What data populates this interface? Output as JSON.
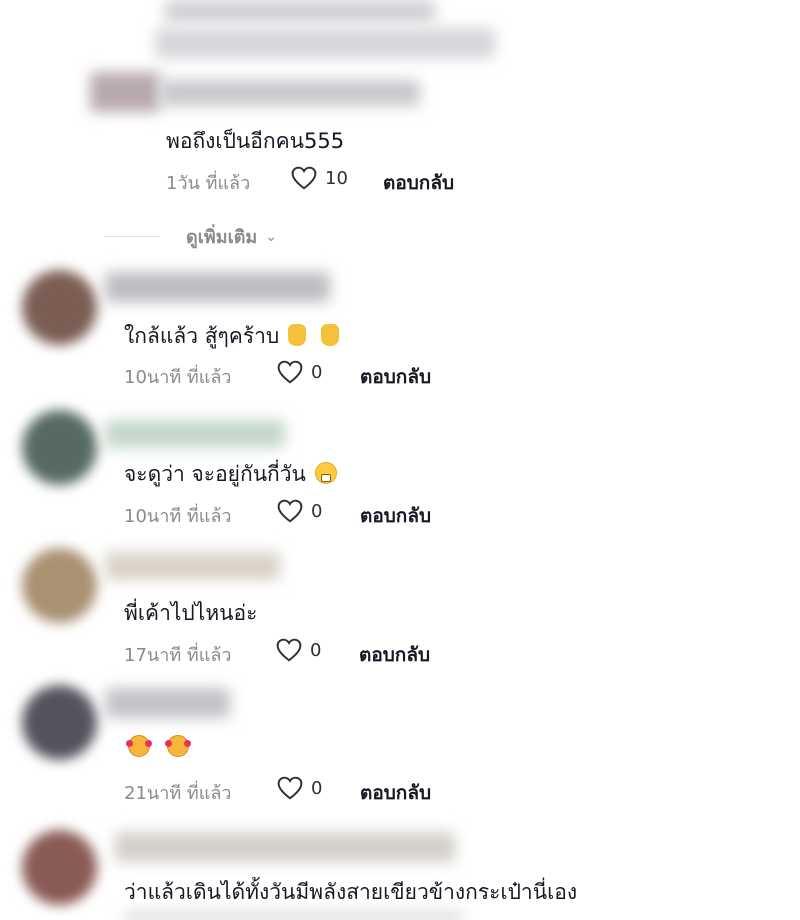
{
  "comments": [
    {
      "text": "พอถึงเป็นอีกคน555",
      "time": "1วัน ที่แล้ว",
      "likes": "10",
      "reply": "ตอบกลับ"
    },
    {
      "text": "ใกล้แล้ว สู้ๆคร้าบ",
      "emojis": [
        "victory-hand-emoji",
        "victory-hand-emoji"
      ],
      "time": "10นาที ที่แล้ว",
      "likes": "0",
      "reply": "ตอบกลับ"
    },
    {
      "text": "จะดูว่า จะอยู่กันกี่วัน",
      "emojis": [
        "grinning-face-emoji"
      ],
      "time": "10นาที ที่แล้ว",
      "likes": "0",
      "reply": "ตอบกลับ"
    },
    {
      "text": "พี่เค้าไปไหนอ่ะ",
      "time": "17นาที ที่แล้ว",
      "likes": "0",
      "reply": "ตอบกลับ"
    },
    {
      "text": "",
      "emojis": [
        "smiling-face-with-hearts-emoji",
        "smiling-face-with-hearts-emoji"
      ],
      "time": "21นาที ที่แล้ว",
      "likes": "0",
      "reply": "ตอบกลับ"
    },
    {
      "text": "ว่าแล้วเดินได้ทั้งวันมีพลังสายเขียวข้างกระเป๋านี่เอง"
    }
  ],
  "see_more": {
    "label": "ดูเพิ่มเติม",
    "icon": "chevron-down-icon"
  },
  "colors": {
    "text": "#161823",
    "meta": "#8a8b91",
    "divider": "#e3e3e4"
  }
}
